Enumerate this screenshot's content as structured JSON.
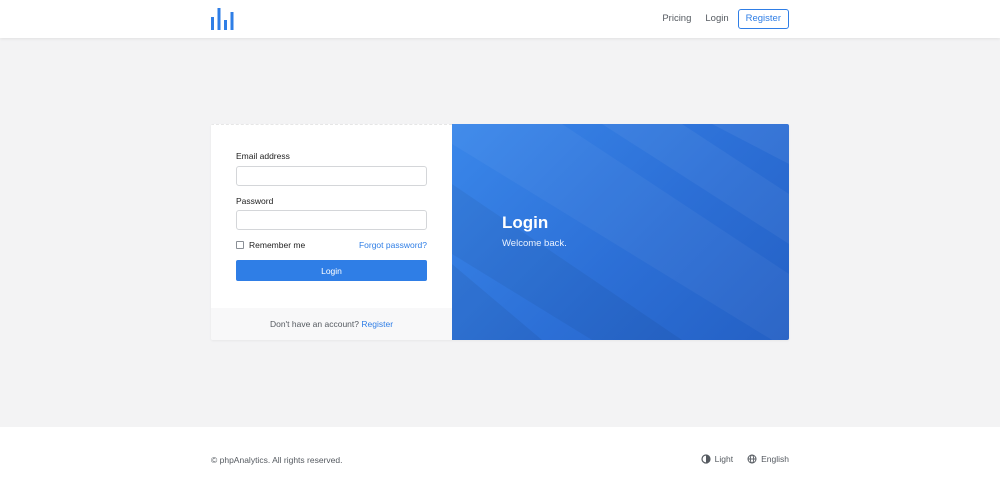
{
  "header": {
    "logo_icon": "bar-chart-logo-icon",
    "nav": {
      "pricing": "Pricing",
      "login": "Login",
      "register": "Register"
    }
  },
  "login_form": {
    "email_label": "Email address",
    "email_value": "",
    "password_label": "Password",
    "password_value": "",
    "remember_label": "Remember me",
    "remember_checked": false,
    "forgot_link": "Forgot password?",
    "submit_label": "Login",
    "footer_text": "Don't have an account?",
    "footer_link": "Register"
  },
  "hero": {
    "title": "Login",
    "subtitle": "Welcome back."
  },
  "footer": {
    "copyright": "© phpAnalytics. All rights reserved.",
    "theme_label": "Light",
    "theme_icon": "contrast-icon",
    "language_label": "English",
    "language_icon": "globe-icon"
  },
  "colors": {
    "accent": "#2f7ee6",
    "background": "#f3f3f4"
  }
}
